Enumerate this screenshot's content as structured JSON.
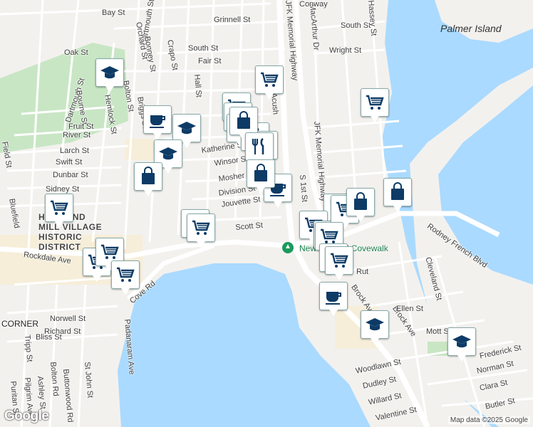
{
  "map": {
    "attribution": "Map data ©2025 Google",
    "logo": "Google",
    "island_label": "Palmer Island",
    "park_label": "New Bedford Covewalk",
    "district_lines": [
      "HOWLAND",
      "MILL VILLAGE",
      "HISTORIC",
      "DISTRICT"
    ],
    "corner_label": "CORNER",
    "colors": {
      "water": "#aadaff",
      "land": "#f3f1ee",
      "park": "#c8e6c4",
      "highway": "#ffffff",
      "pin_icon": "#0d3b66"
    }
  },
  "streets": [
    "Bay St",
    "Grinnell St",
    "South St",
    "Wright St",
    "Fair St",
    "Dartmouth St",
    "Bonney St",
    "Orchard St",
    "Oak St",
    "Crapo St",
    "Hall St",
    "Briggs St",
    "Bolton St",
    "Hemlock St",
    "Bourne St",
    "Fruit St",
    "River St",
    "Larch St",
    "Swift St",
    "Dunbar St",
    "Sidney St",
    "Field St",
    "Katherine St",
    "Winsor St",
    "Mosher St",
    "Division St",
    "Jouvette St",
    "Scott St",
    "JFK Memorial Highway",
    "MacArthur Dr",
    "Acush",
    "S 1st St",
    "Rodney French Blvd",
    "Cleveland St",
    "Rockdale Ave",
    "Cove Rd",
    "Brock Ave",
    "Ellen St",
    "Mott St",
    "Frederick St",
    "Norman St",
    "Clara St",
    "Butler St",
    "Woodlawn St",
    "Dudley St",
    "Willard St",
    "Valentine St",
    "Norwell St",
    "Richard St",
    "Bliss St",
    "Tripp St",
    "Padanaram Ave",
    "Bolton Rd",
    "Buttonwood Rd",
    "St John St",
    "Ashley St",
    "Pilgrim Ave",
    "Puritan St",
    "Bluefield",
    "Conway",
    "Hassey St",
    "Rut",
    "Ellen St"
  ],
  "pins": [
    {
      "icon": "school-icon"
    },
    {
      "icon": "cafe-icon"
    },
    {
      "icon": "school-icon"
    },
    {
      "icon": "school-icon"
    },
    {
      "icon": "shopping-bag-icon"
    },
    {
      "icon": "grocery-cart-icon"
    },
    {
      "icon": "grocery-cart-icon"
    },
    {
      "icon": "grocery-cart-icon"
    },
    {
      "icon": "grocery-cart-icon"
    },
    {
      "icon": "grocery-cart-icon"
    },
    {
      "icon": "grocery-cart-icon"
    },
    {
      "icon": "grocery-cart-icon"
    },
    {
      "icon": "grocery-cart-icon"
    },
    {
      "icon": "grocery-cart-icon"
    },
    {
      "icon": "restaurant-icon"
    },
    {
      "icon": "restaurant-icon"
    },
    {
      "icon": "shopping-bag-icon"
    },
    {
      "icon": "cafe-icon"
    },
    {
      "icon": "grocery-cart-icon"
    },
    {
      "icon": "restaurant-icon"
    },
    {
      "icon": "shopping-bag-icon"
    },
    {
      "icon": "shopping-bag-icon"
    },
    {
      "icon": "restaurant-icon"
    },
    {
      "icon": "grocery-cart-icon"
    },
    {
      "icon": "grocery-cart-icon"
    },
    {
      "icon": "shopping-bag-icon"
    },
    {
      "icon": "cafe-icon"
    },
    {
      "icon": "school-icon"
    },
    {
      "icon": "school-icon"
    }
  ]
}
